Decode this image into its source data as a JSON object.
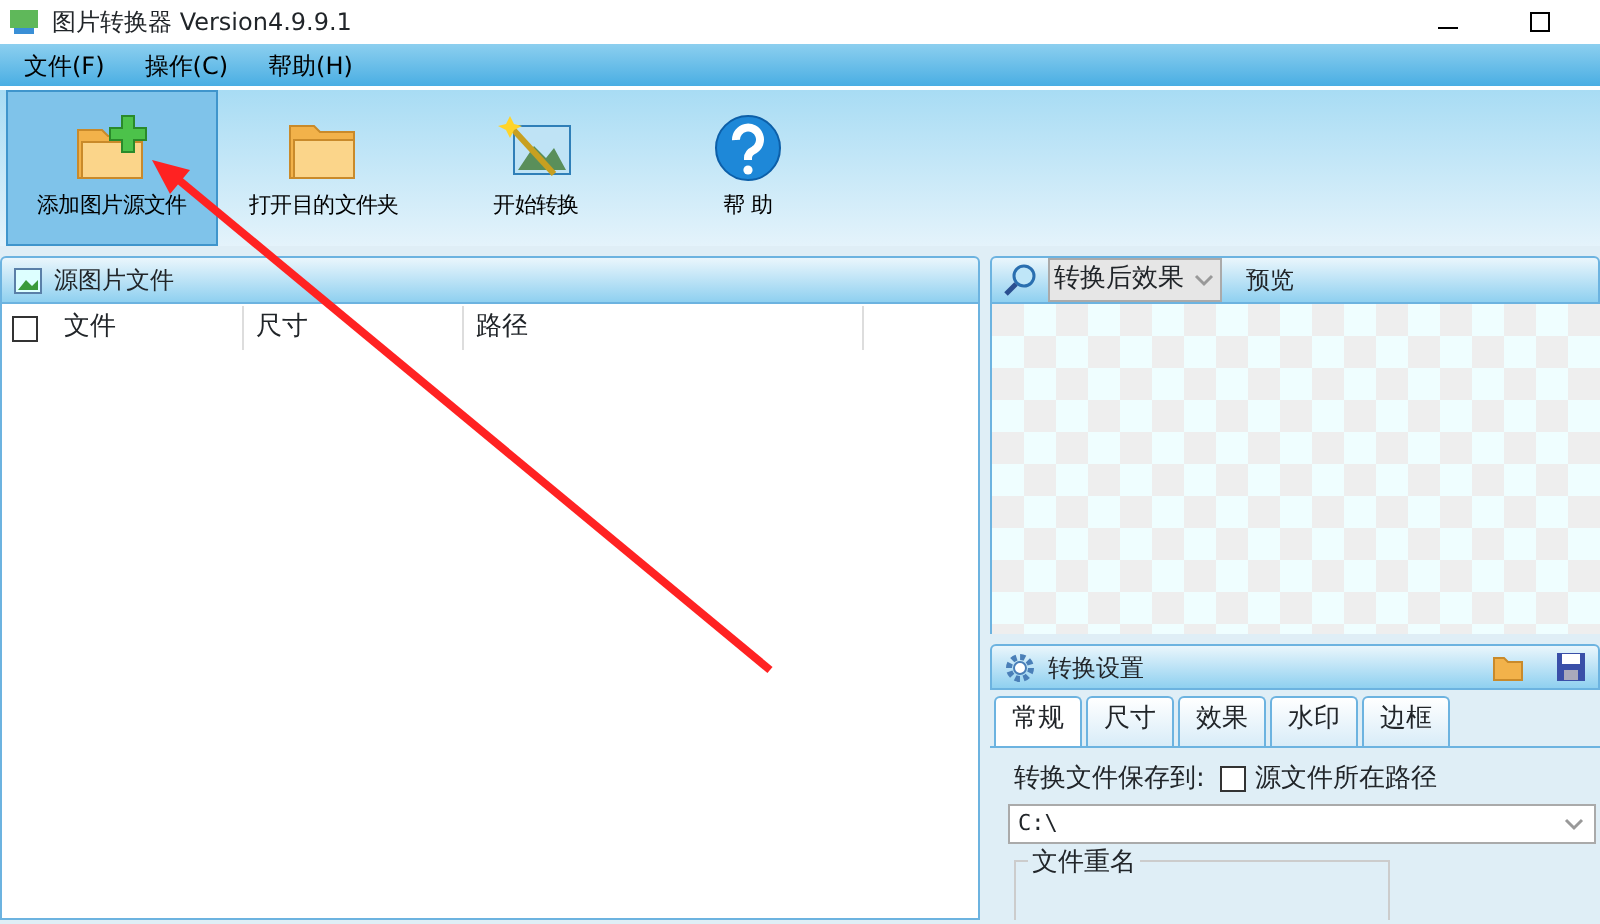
{
  "window": {
    "title": "图片转换器 Version4.9.9.1"
  },
  "menu": [
    "文件(F)",
    "操作(C)",
    "帮助(H)"
  ],
  "toolbar": [
    {
      "label": "添加图片源文件",
      "kind": "add-folder",
      "selected": true
    },
    {
      "label": "打开目的文件夹",
      "kind": "folder",
      "selected": false
    },
    {
      "label": "开始转换",
      "kind": "wand",
      "selected": false
    },
    {
      "label": "帮 助",
      "kind": "help",
      "selected": false
    }
  ],
  "source_panel": {
    "title": "源图片文件",
    "select_all": {
      "checked": false
    },
    "columns": [
      "文件",
      "尺寸",
      "路径"
    ]
  },
  "preview": {
    "mode": "转换后效果",
    "label": "预览"
  },
  "settings": {
    "title": "转换设置",
    "tabs": [
      {
        "label": "常规",
        "selected": true
      },
      {
        "label": "尺寸",
        "selected": false
      },
      {
        "label": "效果",
        "selected": false
      },
      {
        "label": "水印",
        "selected": false
      },
      {
        "label": "边框",
        "selected": false
      }
    ],
    "save_to_label": "转换文件保存到:",
    "same_path": {
      "label": "源文件所在路径",
      "checked": false
    },
    "path": "C:\\",
    "rename_group": "文件重名"
  }
}
